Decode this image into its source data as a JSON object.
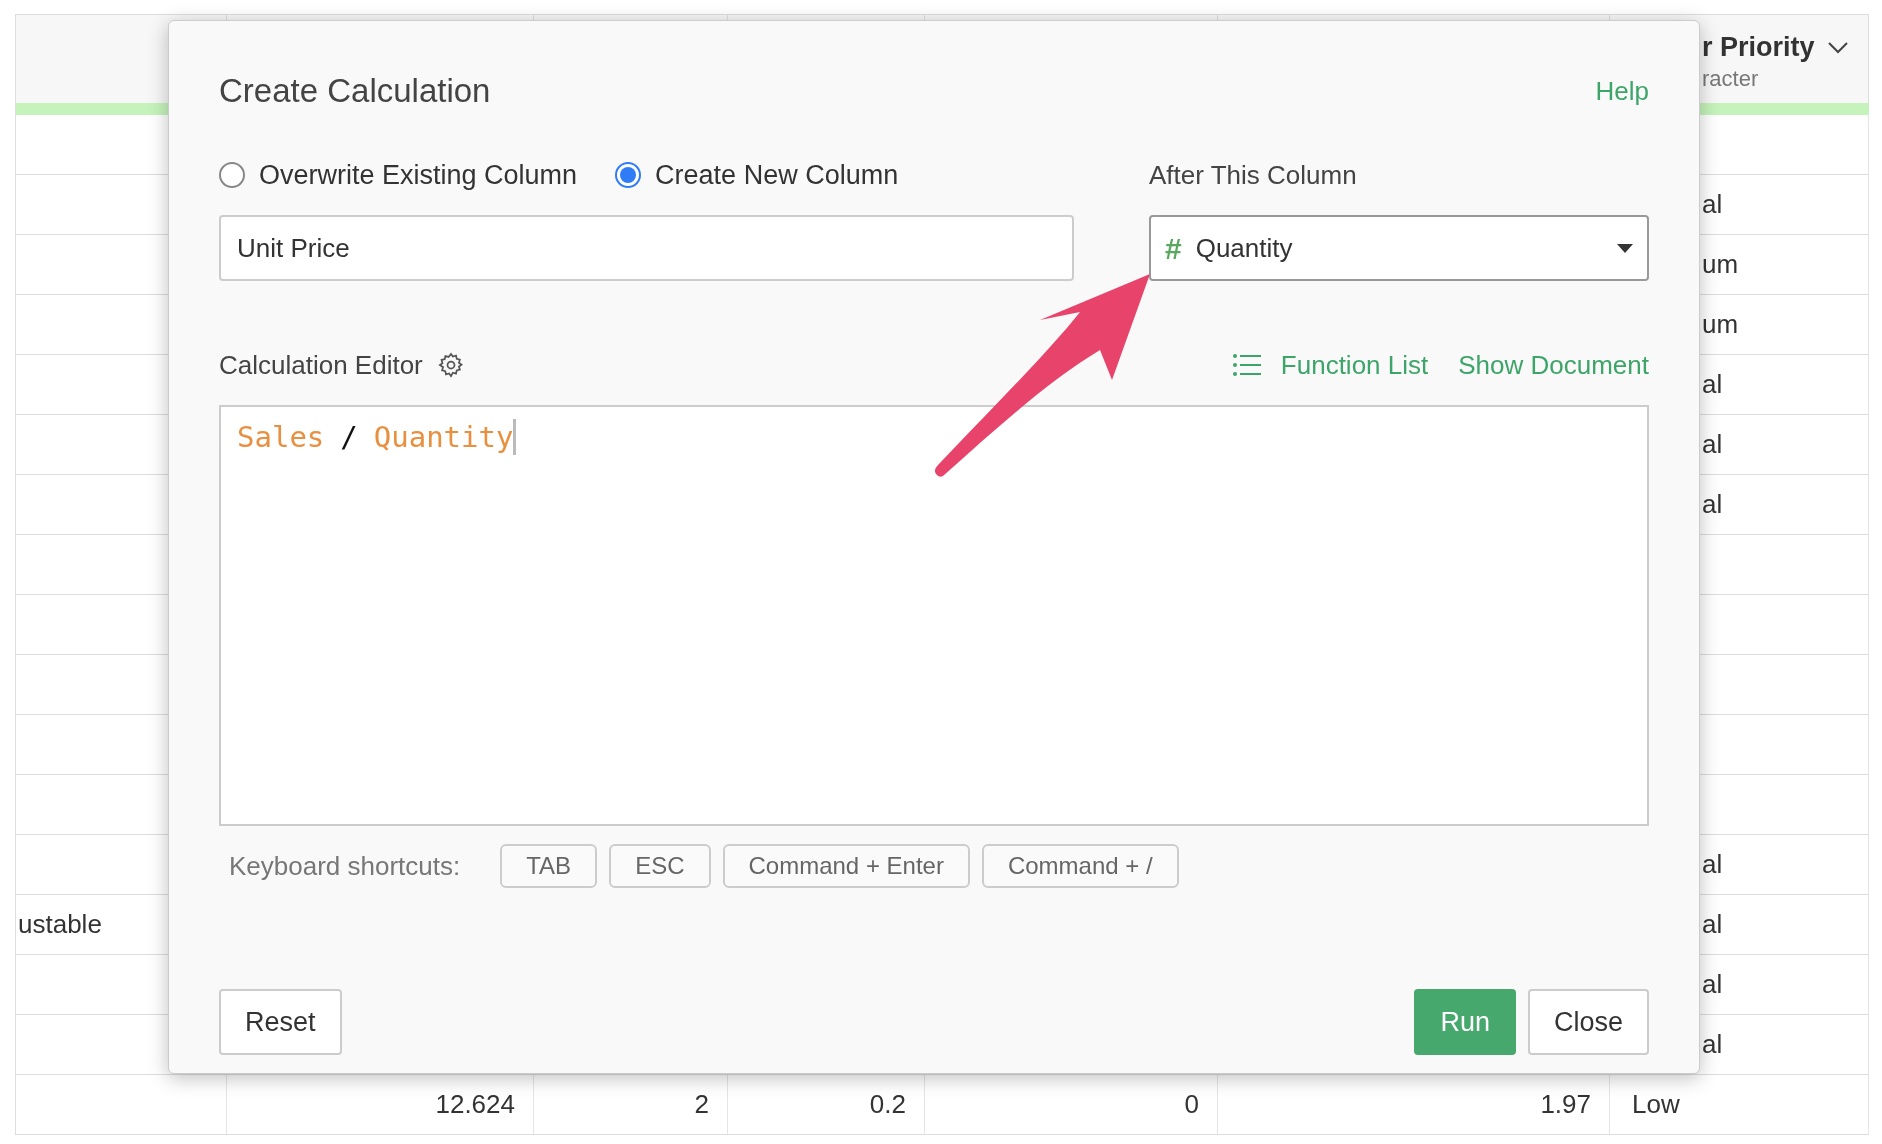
{
  "table": {
    "header": {
      "column_7": {
        "title": "r Priority",
        "subtitle": "racter"
      }
    },
    "rows": [
      {},
      {
        "column_7": "al"
      },
      {
        "column_7": "um"
      },
      {
        "column_7": "um"
      },
      {
        "column_7": "al"
      },
      {
        "column_7": "al"
      },
      {
        "column_7": "al"
      },
      {},
      {},
      {},
      {},
      {},
      {
        "column_7": "al"
      },
      {
        "column_1": "ustable",
        "column_7": "al"
      },
      {
        "column_7": "al"
      },
      {
        "column_7": "al"
      },
      {
        "column_2": "12.624",
        "column_3": "2",
        "column_4": "0.2",
        "column_5": "0",
        "column_6": "1.97",
        "column_7": "Low"
      }
    ]
  },
  "dialog": {
    "title": "Create Calculation",
    "help_link": "Help",
    "mode_options": [
      {
        "label": "Overwrite Existing Column",
        "selected": false
      },
      {
        "label": "Create New Column",
        "selected": true
      }
    ],
    "column_name": {
      "value": "Unit Price"
    },
    "after_column": {
      "label": "After This Column",
      "type_glyph": "#",
      "value": "Quantity"
    },
    "editor": {
      "label": "Calculation Editor",
      "function_list_link": "Function List",
      "show_document_link": "Show Document",
      "tokens": [
        {
          "text": "Sales",
          "kind": "column"
        },
        {
          "text": "/",
          "kind": "operator"
        },
        {
          "text": "Quantity",
          "kind": "column"
        }
      ]
    },
    "shortcuts": {
      "label": "Keyboard shortcuts:",
      "keys": [
        "TAB",
        "ESC",
        "Command + Enter",
        "Command + /"
      ]
    },
    "left_buttons": [
      {
        "label": "Reset",
        "kind": "default"
      }
    ],
    "right_buttons": [
      {
        "label": "Run",
        "kind": "primary"
      },
      {
        "label": "Close",
        "kind": "default"
      }
    ]
  }
}
